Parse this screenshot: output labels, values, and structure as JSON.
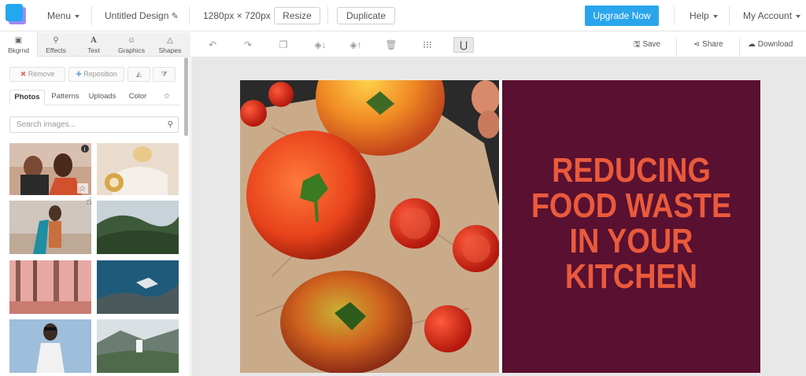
{
  "app": {
    "menu_label": "Menu",
    "design_title": "Untitled Design",
    "dimensions": "1280px × 720px",
    "resize_label": "Resize",
    "duplicate_label": "Duplicate",
    "upgrade_label": "Upgrade Now",
    "help_label": "Help",
    "account_label": "My Account",
    "accent_color": "#2aa5ec"
  },
  "left_panel": {
    "category_tabs": [
      {
        "label": "Bkgrnd",
        "icon": "image-icon"
      },
      {
        "label": "Effects",
        "icon": "wand-icon"
      },
      {
        "label": "Text",
        "icon": "text-icon"
      },
      {
        "label": "Graphics",
        "icon": "smiley-icon"
      },
      {
        "label": "Shapes",
        "icon": "triangle-icon"
      }
    ],
    "remove_label": "Remove",
    "reposition_label": "Reposition",
    "sub_tabs": [
      "Photos",
      "Patterns",
      "Uploads",
      "Color"
    ],
    "search_placeholder": "Search images..."
  },
  "editor_toolbar": {
    "icons": [
      "undo-icon",
      "redo-icon",
      "copy-icon",
      "layer-down-icon",
      "layer-up-icon",
      "trash-icon",
      "grid-icon",
      "magnet-icon"
    ],
    "save_label": "Save",
    "share_label": "Share",
    "download_label": "Download"
  },
  "canvas": {
    "headline_lines": [
      "REDUCING",
      "FOOD WASTE",
      "IN YOUR",
      "KITCHEN"
    ],
    "panel_color": "#5a1030",
    "headline_color": "#ea5a3c"
  }
}
